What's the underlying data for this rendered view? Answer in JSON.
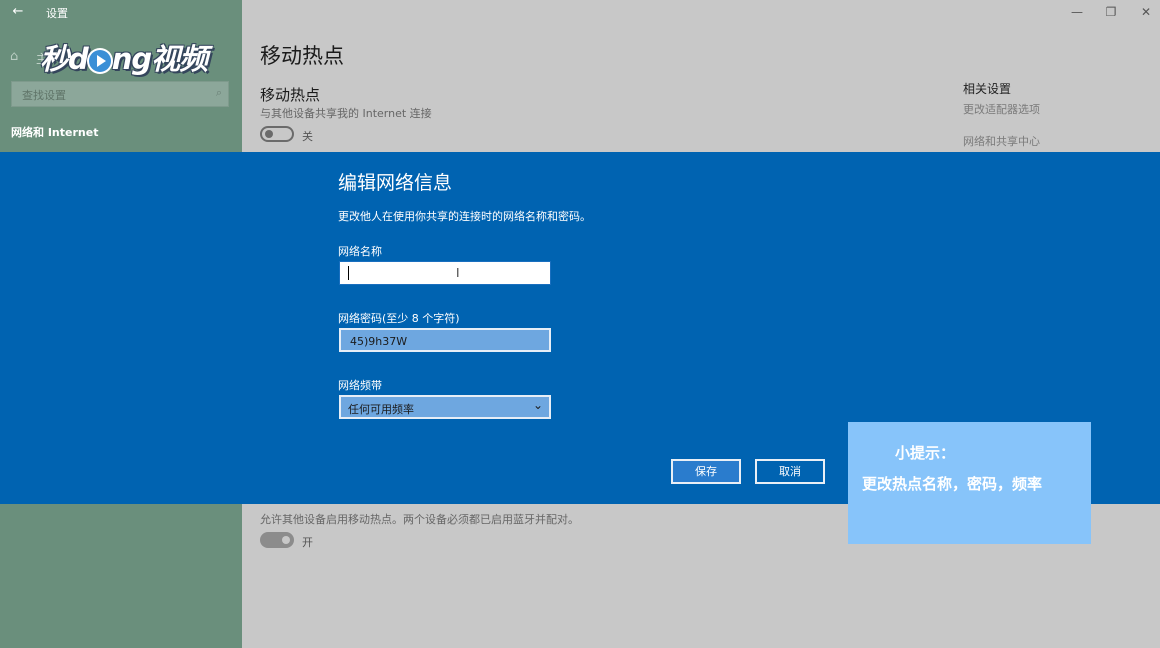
{
  "window": {
    "title": "设置",
    "back_glyph": "←",
    "minimize_glyph": "—",
    "restore_glyph": "❐",
    "close_glyph": "✕"
  },
  "sidebar": {
    "logo_text_left": "秒d",
    "logo_text_right": "ng视频",
    "home_label": "主",
    "search_placeholder": "查找设置",
    "active_item": "网络和 Internet"
  },
  "main": {
    "page_title": "移动热点",
    "section_title": "移动热点",
    "section_desc": "与其他设备共享我的 Internet 连接",
    "toggle_off_label": "关",
    "bluetooth_desc": "允许其他设备启用移动热点。两个设备必须都已启用蓝牙并配对。",
    "toggle_on_label": "开"
  },
  "related": {
    "title": "相关设置",
    "links": [
      "更改适配器选项",
      "网络和共享中心"
    ]
  },
  "dialog": {
    "title": "编辑网络信息",
    "description": "更改他人在使用你共享的连接时的网络名称和密码。",
    "name_label": "网络名称",
    "name_value": "",
    "password_label": "网络密码(至少 8 个字符)",
    "password_value": "45)9h37W",
    "band_label": "网络频带",
    "band_value": "任何可用频率",
    "save_label": "保存",
    "cancel_label": "取消"
  },
  "tip": {
    "line1": "小提示：",
    "line2": "更改热点名称，密码，频率"
  },
  "colors": {
    "dialog_bg": "#0063b1",
    "sidebar_bg": "#6a8f7c",
    "tip_bg": "#87c4fa"
  }
}
